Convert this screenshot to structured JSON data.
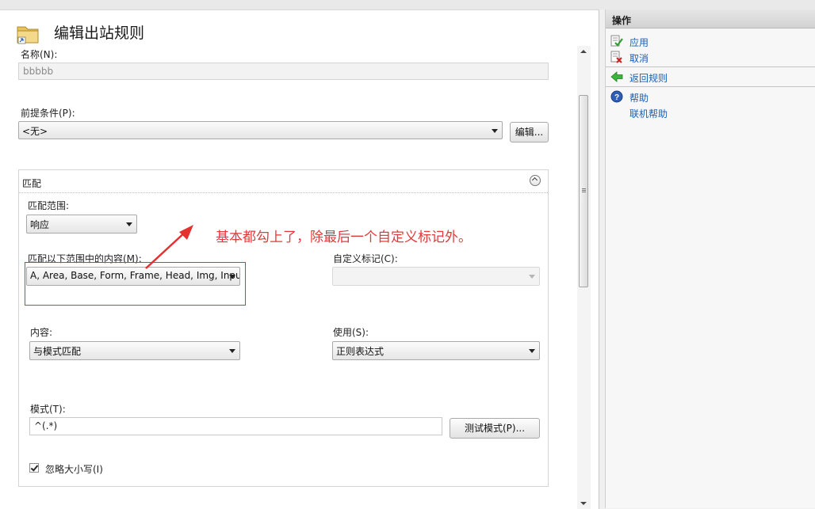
{
  "page": {
    "title": "编辑出站规则"
  },
  "form": {
    "name_label": "名称(N):",
    "name_value": "bbbbb",
    "precondition_label": "前提条件(P):",
    "precondition_value": "<无>",
    "edit_button": "编辑..."
  },
  "match_group": {
    "header": "匹配",
    "scope_label": "匹配范围:",
    "scope_value": "响应",
    "content_in_label": "匹配以下范围中的内容(M):",
    "content_in_value": "A, Area, Base, Form, Frame, Head, Img, Input",
    "custom_tag_label": "自定义标记(C):",
    "custom_tag_value": "",
    "content_label": "内容:",
    "content_value": "与模式匹配",
    "using_label": "使用(S):",
    "using_value": "正则表达式",
    "pattern_label": "模式(T):",
    "pattern_value": "^(.*)",
    "test_pattern_button": "测试模式(P)...",
    "ignore_case_label": "忽略大小写(I)",
    "ignore_case_checked": true
  },
  "annotation": {
    "text": "基本都勾上了，除最后一个自定义标记外。",
    "color": "#e23a3a"
  },
  "actions": {
    "header": "操作",
    "items": [
      {
        "label": "应用",
        "icon": "apply-icon"
      },
      {
        "label": "取消",
        "icon": "cancel-icon"
      },
      {
        "label": "返回规则",
        "icon": "back-arrow-icon"
      },
      {
        "label": "帮助",
        "icon": "help-icon"
      },
      {
        "label": "联机帮助",
        "icon": ""
      }
    ],
    "link_color": "#1a5fb4"
  }
}
